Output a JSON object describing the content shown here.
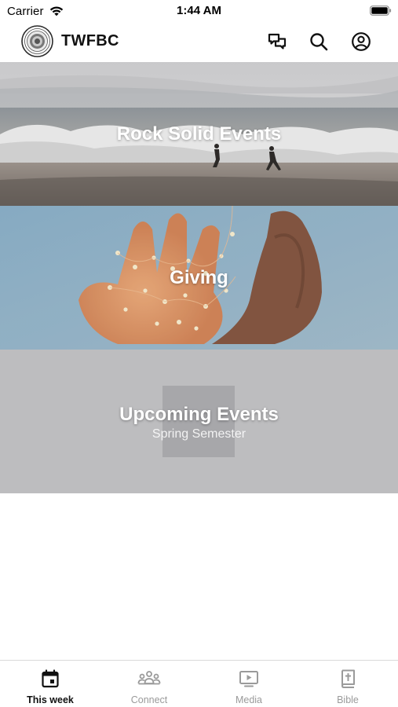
{
  "status_bar": {
    "carrier": "Carrier",
    "time": "1:44 AM",
    "icons": [
      "wifi-icon",
      "battery-icon"
    ]
  },
  "app_bar": {
    "title": "TWFBC",
    "logo": "church-seal-logo",
    "actions": [
      {
        "name": "chat-icon"
      },
      {
        "name": "search-icon"
      },
      {
        "name": "account-icon"
      }
    ]
  },
  "cards": [
    {
      "title": "Rock Solid Events",
      "image": "beach waves with runners"
    },
    {
      "title": "Giving",
      "image": "hands holding string lights"
    },
    {
      "title": "Upcoming Events",
      "subtitle": "Spring Semester",
      "image": "placeholder"
    }
  ],
  "tab_bar": {
    "tabs": [
      {
        "label": "This week",
        "icon": "calendar-icon",
        "active": true
      },
      {
        "label": "Connect",
        "icon": "people-icon",
        "active": false
      },
      {
        "label": "Media",
        "icon": "play-screen-icon",
        "active": false
      },
      {
        "label": "Bible",
        "icon": "bible-icon",
        "active": false
      }
    ]
  },
  "colors": {
    "active_tab": "#111111",
    "inactive_tab": "#9a9a9a",
    "placeholder_card": "#bdbdbf",
    "placeholder_inner": "#a7a7aa"
  }
}
